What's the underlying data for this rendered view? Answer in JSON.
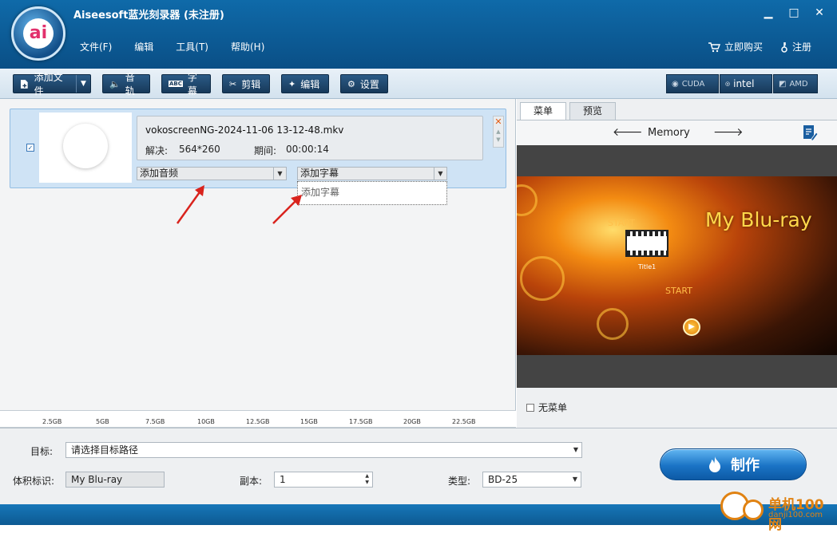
{
  "app": {
    "title": "Aiseesoft蓝光刻录器 (未注册)",
    "logo_text": "ai"
  },
  "window": {
    "minimize": "▁",
    "maximize": "□",
    "close": "✕"
  },
  "menu": [
    "文件(F)",
    "编辑",
    "工具(T)",
    "帮助(H)"
  ],
  "header_links": {
    "buy": "立即购买",
    "register": "注册"
  },
  "toolbar": {
    "add_file": "添加文件",
    "audio": "音轨",
    "subtitle": "字幕",
    "cut": "剪辑",
    "edit": "编辑",
    "settings": "设置",
    "abc": "ABC",
    "gpu_cuda": "CUDA",
    "gpu_intel": "intel",
    "gpu_amd": "AMD"
  },
  "file_item": {
    "checked": "✓",
    "filename": "vokoscreenNG-2024-11-06 13-12-48.mkv",
    "resolution_label": "解决:",
    "resolution": "564*260",
    "duration_label": "期间:",
    "duration": "00:00:14",
    "audio_combo": "添加音频",
    "subtitle_combo": "添加字幕",
    "subtitle_option": "添加字幕"
  },
  "ruler": [
    "2.5GB",
    "5GB",
    "7.5GB",
    "10GB",
    "12.5GB",
    "15GB",
    "17.5GB",
    "20GB",
    "22.5GB"
  ],
  "right_panel": {
    "tabs": [
      "菜单",
      "预览"
    ],
    "nav_title": "Memory",
    "preview_title": "My Blu-ray",
    "start1": "START",
    "start2": "START",
    "title1": "Title1",
    "no_menu": "无菜单"
  },
  "bottom": {
    "target_label": "目标:",
    "target_value": "请选择目标路径",
    "volume_label": "体积标识:",
    "volume_value": "My Blu-ray",
    "copies_label": "副本:",
    "copies_value": "1",
    "type_label": "类型:",
    "type_value": "BD-25",
    "make_button": "制作"
  },
  "watermark": {
    "text": "单机100网",
    "sub": "danji100.com"
  },
  "colors": {
    "titlebar": "#0f6aa9",
    "accent": "#1a73c5",
    "arrow_red": "#d9231d",
    "selection": "#cfe3f5"
  }
}
